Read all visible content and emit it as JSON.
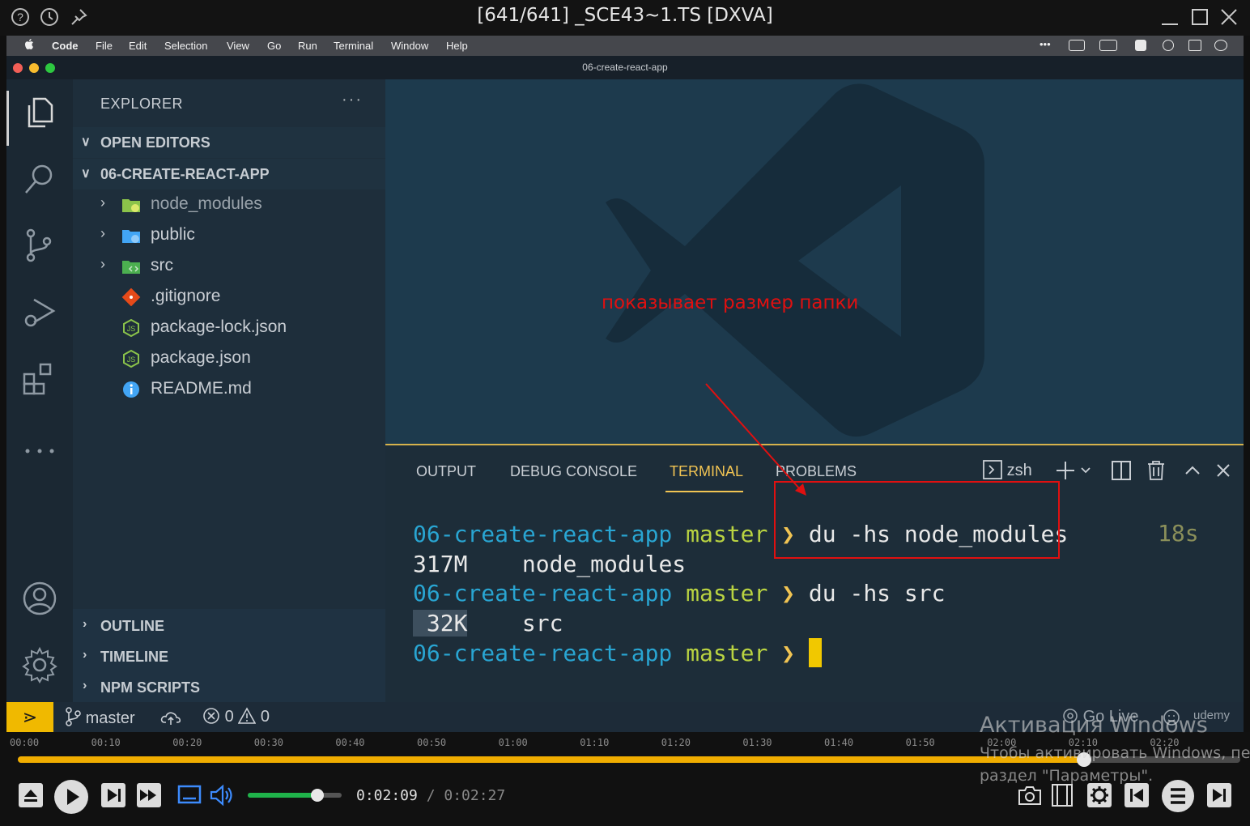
{
  "player": {
    "title": "[641/641] _SCE43~1.TS [DXVA]",
    "current_time": "0:02:09",
    "separator": " / ",
    "total_time": "0:02:27",
    "timeline_labels": [
      "00:00",
      "00:10",
      "00:20",
      "00:30",
      "00:40",
      "00:50",
      "01:00",
      "01:10",
      "01:20",
      "01:30",
      "01:40",
      "01:50",
      "02:00",
      "02:10",
      "02:20"
    ],
    "progress_fraction": 0.872,
    "volume_fraction": 0.74
  },
  "macos_menu": {
    "app_name": "Code",
    "items": [
      "File",
      "Edit",
      "Selection",
      "View",
      "Go",
      "Run",
      "Terminal",
      "Window",
      "Help"
    ],
    "tray_more": "•••"
  },
  "vscode": {
    "window_title": "06-create-react-app",
    "explorer": {
      "header": "EXPLORER",
      "more": "···",
      "open_editors": "OPEN EDITORS",
      "project": "06-CREATE-REACT-APP",
      "items": [
        {
          "name": "node_modules",
          "icon": "folder-node-icon"
        },
        {
          "name": "public",
          "icon": "folder-public-icon"
        },
        {
          "name": "src",
          "icon": "folder-src-icon"
        },
        {
          "name": ".gitignore",
          "icon": "git-icon"
        },
        {
          "name": "package-lock.json",
          "icon": "nodejs-icon"
        },
        {
          "name": "package.json",
          "icon": "nodejs-icon"
        },
        {
          "name": "README.md",
          "icon": "info-icon"
        }
      ],
      "outline": "OUTLINE",
      "timeline": "TIMELINE",
      "npm_scripts": "NPM SCRIPTS"
    },
    "panel": {
      "tabs": [
        "OUTPUT",
        "DEBUG CONSOLE",
        "TERMINAL",
        "PROBLEMS"
      ],
      "active_tab": "TERMINAL",
      "shell": "zsh",
      "duration": "18s",
      "prompt_dir": "06-create-react-app",
      "prompt_branch": "master",
      "prompt_arrow": "❯",
      "lines": [
        {
          "type": "cmd",
          "text": "du -hs node_modules"
        },
        {
          "type": "out",
          "size": "317M",
          "name": "node_modules"
        },
        {
          "type": "cmd",
          "text": "du -hs src"
        },
        {
          "type": "out",
          "size": "32K",
          "name": "src"
        }
      ]
    },
    "statusbar": {
      "branch": "master",
      "errors": "0",
      "warnings": "0",
      "go_live": "Go Live",
      "brand": "udemy"
    }
  },
  "annotation": {
    "text": "показывает размер папки",
    "color": "#e01010"
  },
  "watermark": {
    "line1": "Активация Windows",
    "line2": "Чтобы активировать Windows, пе",
    "line3": "раздел \"Параметры\"."
  },
  "colors": {
    "accent": "#f1c453",
    "prompt_dir": "#29a5d2",
    "prompt_branch": "#b9d341",
    "timeline": "#f0ad00"
  }
}
